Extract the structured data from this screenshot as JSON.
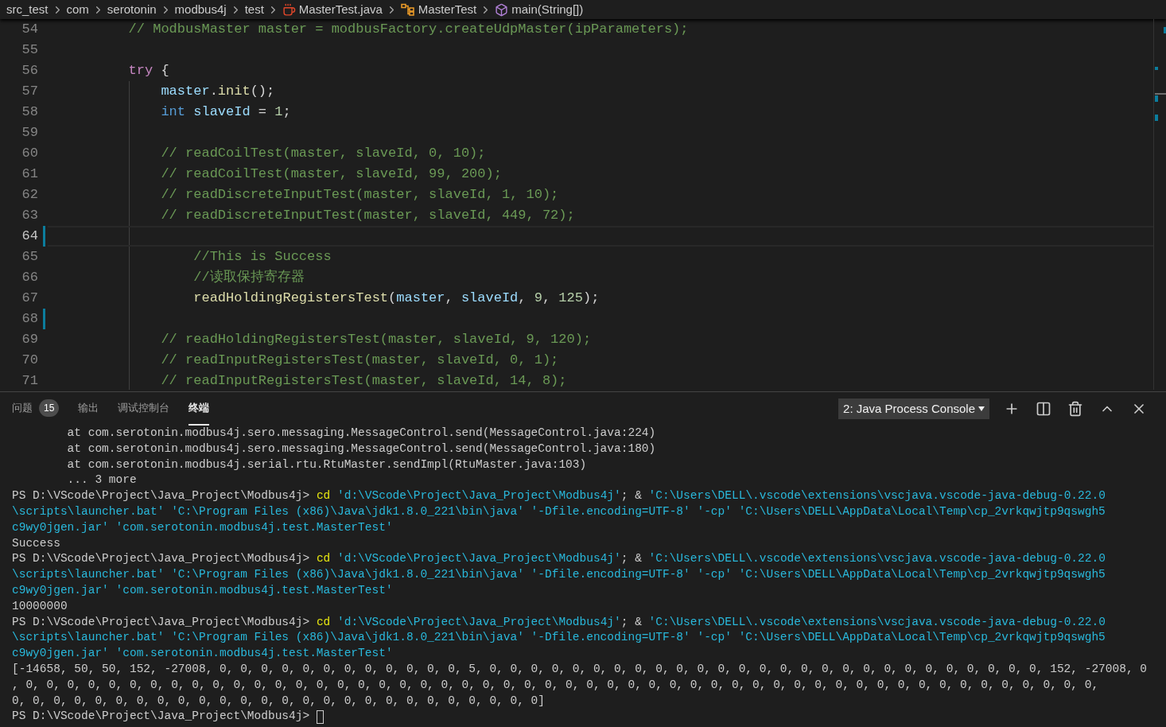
{
  "breadcrumb": [
    {
      "kind": "folder",
      "label": "src_test"
    },
    {
      "kind": "folder",
      "label": "com"
    },
    {
      "kind": "folder",
      "label": "serotonin"
    },
    {
      "kind": "folder",
      "label": "modbus4j"
    },
    {
      "kind": "folder",
      "label": "test"
    },
    {
      "kind": "java",
      "label": "MasterTest.java"
    },
    {
      "kind": "class",
      "label": "MasterTest"
    },
    {
      "kind": "method",
      "label": "main(String[])"
    }
  ],
  "editor": {
    "lines": [
      {
        "number": "54",
        "current": false,
        "modified": false,
        "tokens": [
          {
            "kind": "comment",
            "text": "        // ModbusMaster master = modbusFactory.createUdpMaster(ipParameters);"
          }
        ]
      },
      {
        "number": "55",
        "current": false,
        "modified": false
      },
      {
        "number": "56",
        "current": false,
        "modified": false,
        "tokens": [
          {
            "kind": "keyword",
            "text": "        try"
          },
          {
            "kind": "plain",
            "text": " {"
          }
        ]
      },
      {
        "number": "57",
        "current": false,
        "modified": false,
        "tokens": [
          {
            "kind": "variable",
            "text": "            master"
          },
          {
            "kind": "plain",
            "text": "."
          },
          {
            "kind": "function",
            "text": "init"
          },
          {
            "kind": "plain",
            "text": "();"
          }
        ]
      },
      {
        "number": "58",
        "current": false,
        "modified": false,
        "tokens": [
          {
            "kind": "type",
            "text": "            int"
          },
          {
            "kind": "variable",
            "text": " slaveId"
          },
          {
            "kind": "plain",
            "text": " = "
          },
          {
            "kind": "number",
            "text": "1"
          },
          {
            "kind": "plain",
            "text": ";"
          }
        ]
      },
      {
        "number": "59",
        "current": false,
        "modified": false
      },
      {
        "number": "60",
        "current": false,
        "modified": false,
        "tokens": [
          {
            "kind": "comment",
            "text": "            // readCoilTest(master, slaveId, 0, 10);"
          }
        ]
      },
      {
        "number": "61",
        "current": false,
        "modified": false,
        "tokens": [
          {
            "kind": "comment",
            "text": "            // readCoilTest(master, slaveId, 99, 200);"
          }
        ]
      },
      {
        "number": "62",
        "current": false,
        "modified": false,
        "tokens": [
          {
            "kind": "comment",
            "text": "            // readDiscreteInputTest(master, slaveId, 1, 10);"
          }
        ]
      },
      {
        "number": "63",
        "current": false,
        "modified": false,
        "tokens": [
          {
            "kind": "comment",
            "text": "            // readDiscreteInputTest(master, slaveId, 449, 72);"
          }
        ]
      },
      {
        "number": "64",
        "current": true,
        "modified": true
      },
      {
        "number": "65",
        "current": false,
        "modified": false,
        "tokens": [
          {
            "kind": "comment",
            "text": "                //This is Success"
          }
        ]
      },
      {
        "number": "66",
        "current": false,
        "modified": false,
        "tokens": [
          {
            "kind": "comment",
            "text": "                //读取保持寄存器"
          }
        ]
      },
      {
        "number": "67",
        "current": false,
        "modified": false,
        "tokens": [
          {
            "kind": "function",
            "text": "                readHoldingRegistersTest"
          },
          {
            "kind": "plain",
            "text": "("
          },
          {
            "kind": "variable",
            "text": "master"
          },
          {
            "kind": "plain",
            "text": ", "
          },
          {
            "kind": "variable",
            "text": "slaveId"
          },
          {
            "kind": "plain",
            "text": ", "
          },
          {
            "kind": "number",
            "text": "9"
          },
          {
            "kind": "plain",
            "text": ", "
          },
          {
            "kind": "number",
            "text": "125"
          },
          {
            "kind": "plain",
            "text": ");"
          }
        ]
      },
      {
        "number": "68",
        "current": false,
        "modified": true
      },
      {
        "number": "69",
        "current": false,
        "modified": false,
        "tokens": [
          {
            "kind": "comment",
            "text": "            // readHoldingRegistersTest(master, slaveId, 9, 120);"
          }
        ]
      },
      {
        "number": "70",
        "current": false,
        "modified": false,
        "tokens": [
          {
            "kind": "comment",
            "text": "            // readInputRegistersTest(master, slaveId, 0, 1);"
          }
        ]
      },
      {
        "number": "71",
        "current": false,
        "modified": false,
        "tokens": [
          {
            "kind": "comment",
            "text": "            // readInputRegistersTest(master, slaveId, 14, 8);"
          }
        ]
      }
    ]
  },
  "panel": {
    "tabs": [
      {
        "label": "问题",
        "badge": "15",
        "selected": false
      },
      {
        "label": "输出",
        "selected": false
      },
      {
        "label": "调试控制台",
        "selected": false
      },
      {
        "label": "终端",
        "selected": true
      }
    ],
    "terminal_picker": "2: Java Process Console",
    "terminal_lines": [
      [
        {
          "kind": "text",
          "text": "        at com.serotonin.modbus4j.sero.messaging.MessageControl.send(MessageControl.java:224)"
        }
      ],
      [
        {
          "kind": "text",
          "text": "        at com.serotonin.modbus4j.sero.messaging.MessageControl.send(MessageControl.java:180)"
        }
      ],
      [
        {
          "kind": "text",
          "text": "        at com.serotonin.modbus4j.serial.rtu.RtuMaster.sendImpl(RtuMaster.java:103)"
        }
      ],
      [
        {
          "kind": "text",
          "text": "        ... 3 more"
        }
      ],
      [
        {
          "kind": "text",
          "text": "PS D:\\VScode\\Project\\Java_Project\\Modbus4j> "
        },
        {
          "kind": "command",
          "text": "cd"
        },
        {
          "kind": "string",
          "text": " 'd:\\VScode\\Project\\Java_Project\\Modbus4j'"
        },
        {
          "kind": "text",
          "text": "; & "
        },
        {
          "kind": "string",
          "text": "'C:\\Users\\DELL\\.vscode\\extensions\\vscjava.vscode-java-debug-0.22.0"
        }
      ],
      [
        {
          "kind": "string",
          "text": "\\scripts\\launcher.bat' 'C:\\Program Files (x86)\\Java\\jdk1.8.0_221\\bin\\java' '-Dfile.encoding=UTF-8' '-cp' 'C:\\Users\\DELL\\AppData\\Local\\Temp\\cp_2vrkqwjtp9qswgh5"
        }
      ],
      [
        {
          "kind": "string",
          "text": "c9wy0jgen.jar' 'com.serotonin.modbus4j.test.MasterTest'"
        }
      ],
      [
        {
          "kind": "text",
          "text": "Success"
        }
      ],
      [
        {
          "kind": "text",
          "text": "PS D:\\VScode\\Project\\Java_Project\\Modbus4j> "
        },
        {
          "kind": "command",
          "text": "cd"
        },
        {
          "kind": "string",
          "text": " 'd:\\VScode\\Project\\Java_Project\\Modbus4j'"
        },
        {
          "kind": "text",
          "text": "; & "
        },
        {
          "kind": "string",
          "text": "'C:\\Users\\DELL\\.vscode\\extensions\\vscjava.vscode-java-debug-0.22.0"
        }
      ],
      [
        {
          "kind": "string",
          "text": "\\scripts\\launcher.bat' 'C:\\Program Files (x86)\\Java\\jdk1.8.0_221\\bin\\java' '-Dfile.encoding=UTF-8' '-cp' 'C:\\Users\\DELL\\AppData\\Local\\Temp\\cp_2vrkqwjtp9qswgh5"
        }
      ],
      [
        {
          "kind": "string",
          "text": "c9wy0jgen.jar' 'com.serotonin.modbus4j.test.MasterTest'"
        }
      ],
      [
        {
          "kind": "text",
          "text": "10000000"
        }
      ],
      [
        {
          "kind": "text",
          "text": "PS D:\\VScode\\Project\\Java_Project\\Modbus4j> "
        },
        {
          "kind": "command",
          "text": "cd"
        },
        {
          "kind": "string",
          "text": " 'd:\\VScode\\Project\\Java_Project\\Modbus4j'"
        },
        {
          "kind": "text",
          "text": "; & "
        },
        {
          "kind": "string",
          "text": "'C:\\Users\\DELL\\.vscode\\extensions\\vscjava.vscode-java-debug-0.22.0"
        }
      ],
      [
        {
          "kind": "string",
          "text": "\\scripts\\launcher.bat' 'C:\\Program Files (x86)\\Java\\jdk1.8.0_221\\bin\\java' '-Dfile.encoding=UTF-8' '-cp' 'C:\\Users\\DELL\\AppData\\Local\\Temp\\cp_2vrkqwjtp9qswgh5"
        }
      ],
      [
        {
          "kind": "string",
          "text": "c9wy0jgen.jar' 'com.serotonin.modbus4j.test.MasterTest'"
        }
      ],
      [
        {
          "kind": "text",
          "text": "[-14658, 50, 50, 152, -27008, 0, 0, 0, 0, 0, 0, 0, 0, 0, 0, 0, 0, 5, 0, 0, 0, 0, 0, 0, 0, 0, 0, 0, 0, 0, 0, 0, 0, 0, 0, 0, 0, 0, 0, 0, 0, 0, 0, 0, 0, 152, -27008, 0"
        }
      ],
      [
        {
          "kind": "text",
          "text": ", 0, 0, 0, 0, 0, 0, 0, 0, 0, 0, 0, 0, 0, 0, 0, 0, 0, 0, 0, 0, 0, 0, 0, 0, 0, 0, 0, 0, 0, 0, 0, 0, 0, 0, 0, 0, 0, 0, 0, 0, 0, 0, 0, 0, 0, 0, 0, 0, 0, 0, 0, 0,"
        }
      ],
      [
        {
          "kind": "text",
          "text": "0, 0, 0, 0, 0, 0, 0, 0, 0, 0, 0, 0, 0, 0, 0, 0, 0, 0, 0, 0, 0, 0, 0, 0, 0, 0]"
        }
      ],
      [
        {
          "kind": "text",
          "text": "PS D:\\VScode\\Project\\Java_Project\\Modbus4j> "
        },
        {
          "kind": "cursor"
        }
      ]
    ]
  }
}
